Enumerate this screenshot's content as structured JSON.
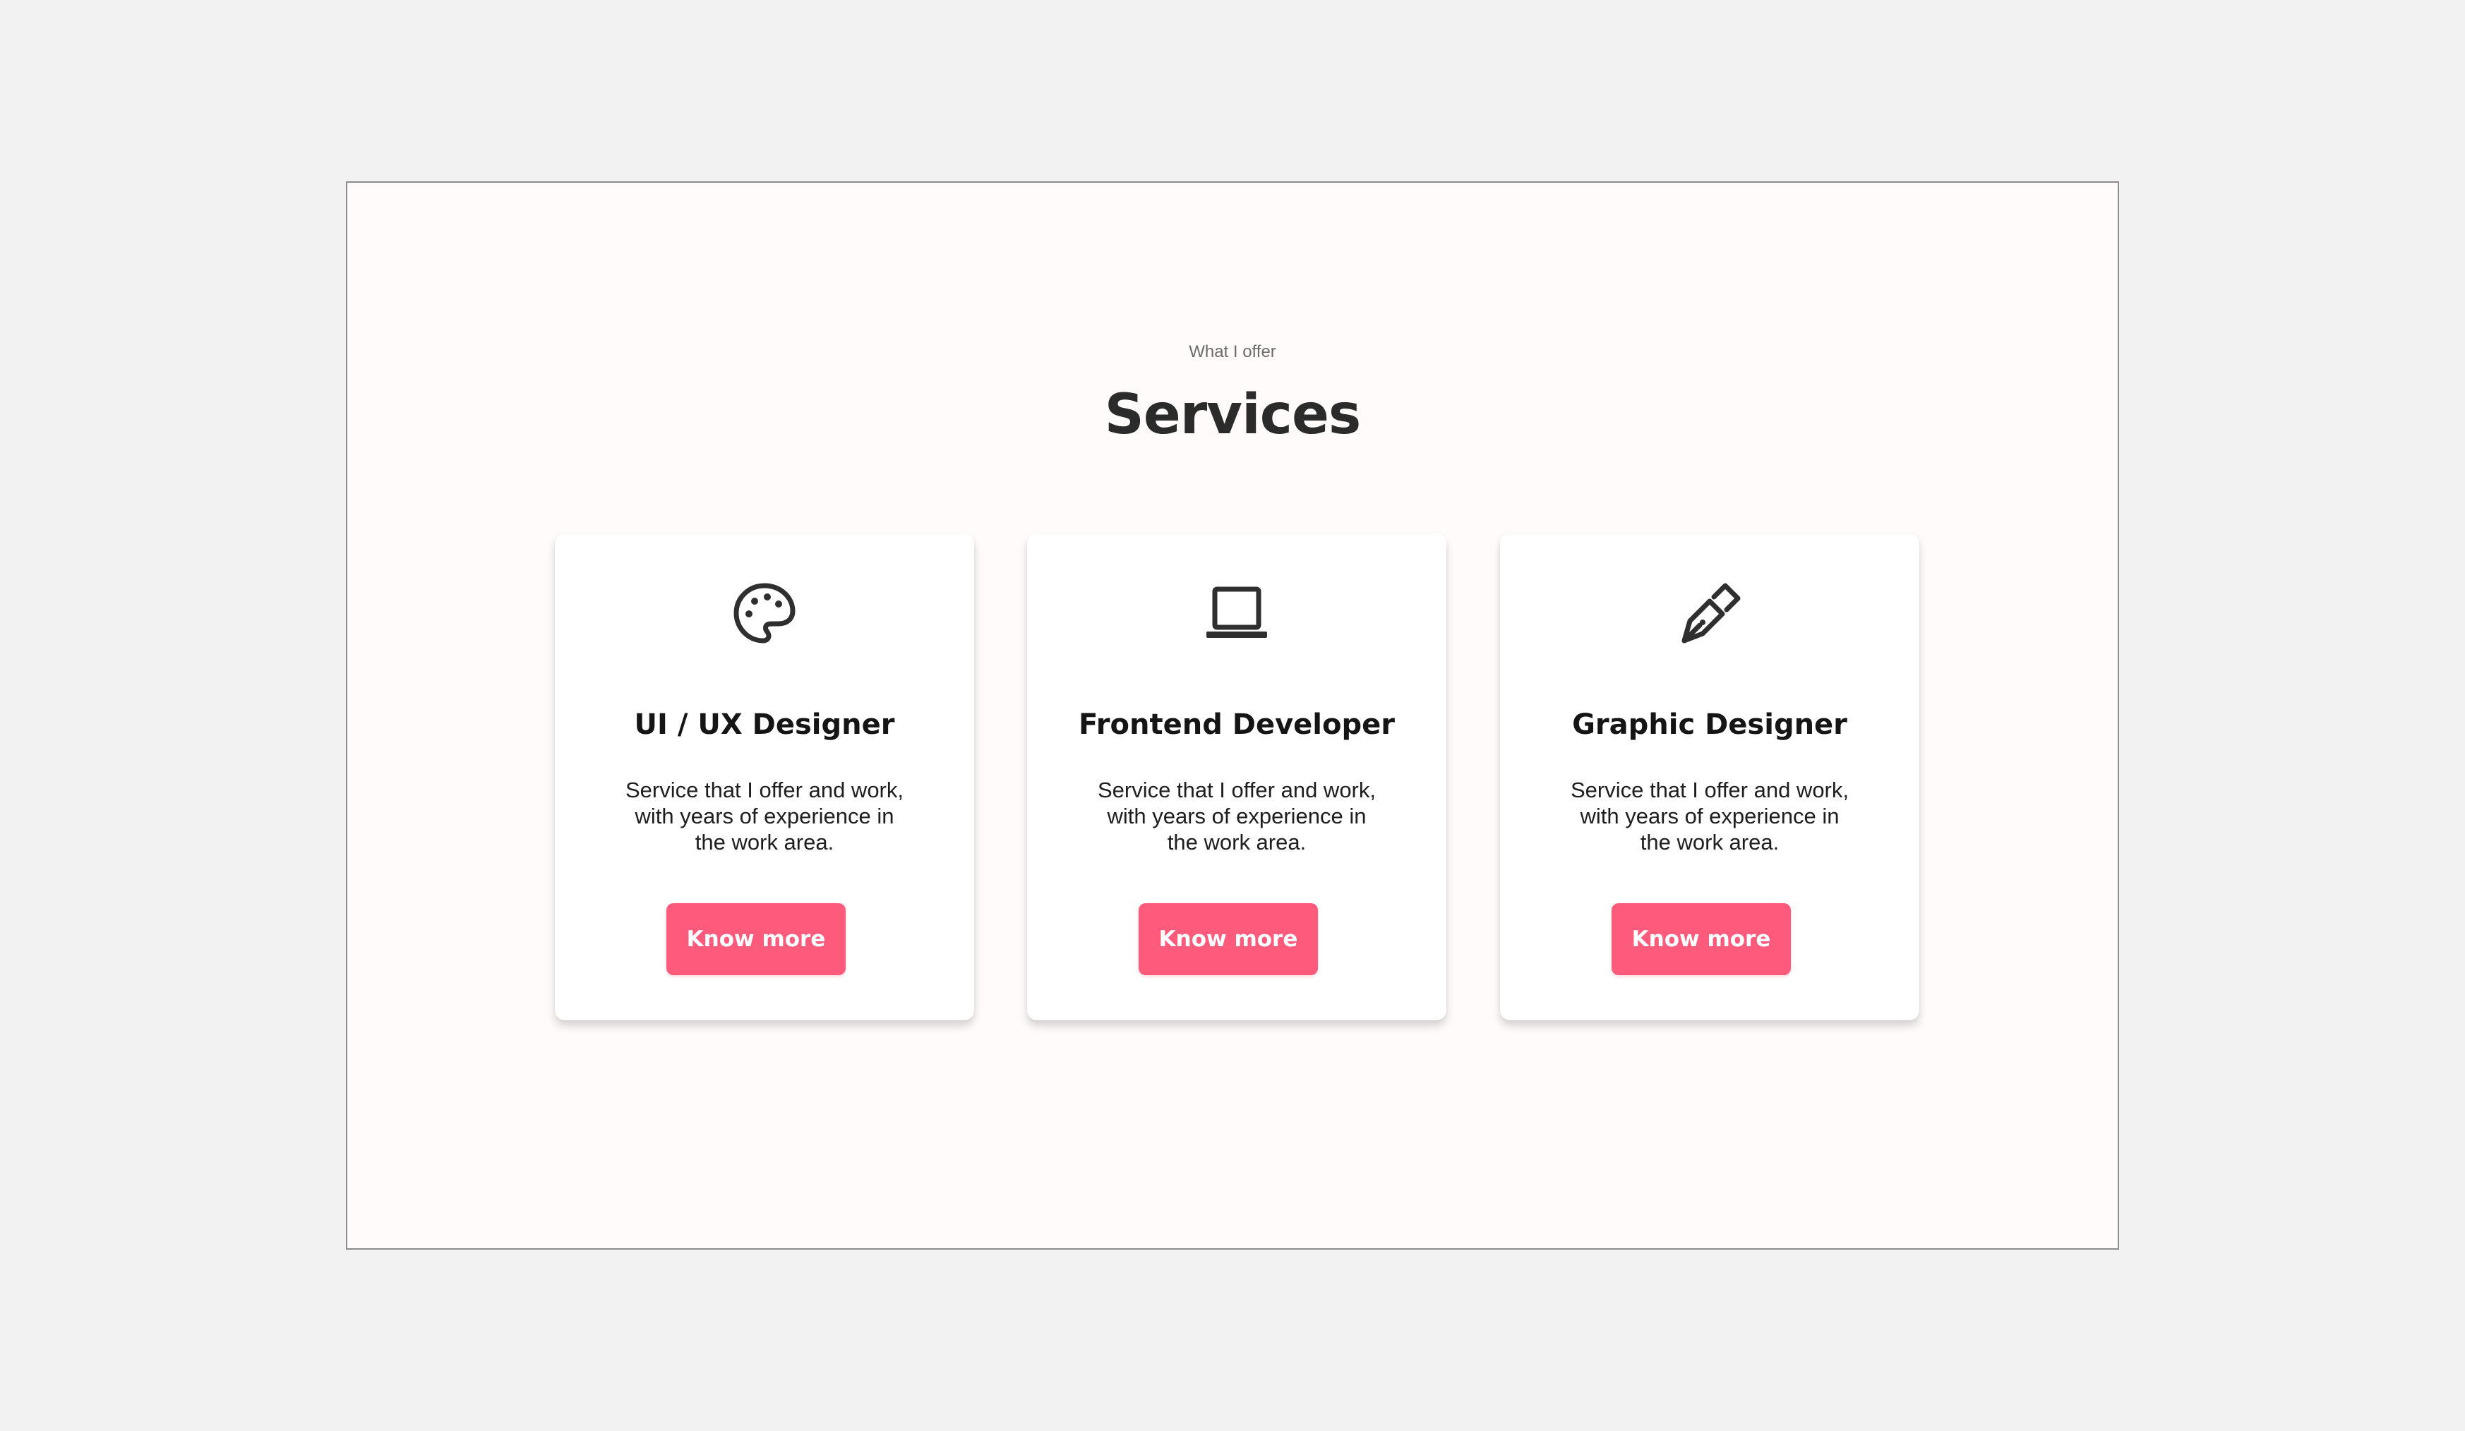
{
  "section": {
    "eyebrow": "What I offer",
    "title": "Services"
  },
  "services": [
    {
      "icon": "palette-icon",
      "title": "UI / UX Designer",
      "description": "Service that I offer and work, with years of experience in the work area.",
      "button_label": "Know more"
    },
    {
      "icon": "laptop-icon",
      "title": "Frontend Developer",
      "description": "Service that I offer and work, with years of experience in the work area.",
      "button_label": "Know more"
    },
    {
      "icon": "pen-nib-icon",
      "title": "Graphic Designer",
      "description": "Service that I offer and work, with years of experience in the work area.",
      "button_label": "Know more"
    }
  ],
  "colors": {
    "page_background": "#f2f2f2",
    "section_background": "#fffbfa",
    "card_background": "#ffffff",
    "accent": "#fe5b7c",
    "heading": "#2b2b2b",
    "icon": "#2f2f2f"
  }
}
